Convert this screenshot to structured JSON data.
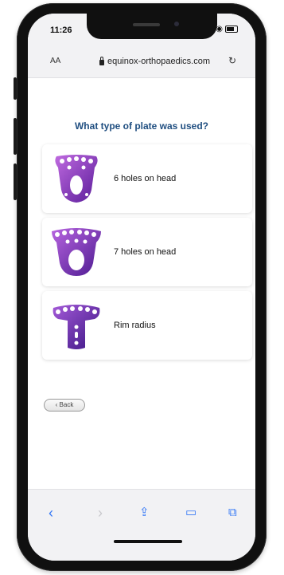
{
  "status_bar": {
    "time": "11:26",
    "signal_glyph": "▐▐",
    "wifi_glyph": "◉"
  },
  "browser": {
    "text_size_label": "AA",
    "url": "equinox-orthopaedics.com",
    "reload_glyph": "↻"
  },
  "page": {
    "question": "What type of plate was used?",
    "options": [
      {
        "label": "6 holes on head",
        "icon": "plate-6-holes-icon"
      },
      {
        "label": "7 holes on head",
        "icon": "plate-7-holes-icon"
      },
      {
        "label": "Rim radius",
        "icon": "rim-radius-plate-icon"
      }
    ],
    "back_label": "‹ Back"
  },
  "toolbar": {
    "back_glyph": "‹",
    "forward_glyph": "›",
    "share_glyph": "⇪",
    "bookmarks_glyph": "▭",
    "tabs_glyph": "⧉"
  },
  "colors": {
    "question": "#1f4e80",
    "plate_purple": "#7a2fb8",
    "ios_blue": "#3478f6"
  }
}
